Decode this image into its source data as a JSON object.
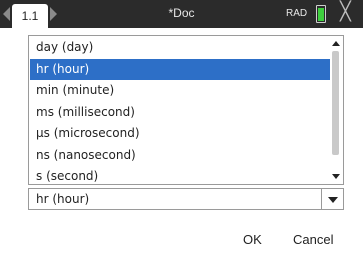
{
  "topbar": {
    "tab_label": "1.1",
    "doc_title": "*Doc",
    "mode": "RAD",
    "close_glyph": "╳"
  },
  "background": {
    "label": "U"
  },
  "list": {
    "items": [
      {
        "label": "day (day)"
      },
      {
        "label": "hr (hour)"
      },
      {
        "label": "min (minute)"
      },
      {
        "label": "ms (millisecond)"
      },
      {
        "label": "µs (microsecond)"
      },
      {
        "label": "ns (nanosecond)"
      },
      {
        "label": "s (second)"
      }
    ],
    "selected_index": 1
  },
  "combo": {
    "value": "hr (hour)"
  },
  "buttons": {
    "ok": "OK",
    "cancel": "Cancel"
  },
  "colors": {
    "topbar": "#2b2b2b",
    "selection": "#2d6fc7",
    "battery": "#3ecf3e"
  },
  "icons": [
    "nav-left-icon",
    "nav-right-icon",
    "battery-icon",
    "close-icon",
    "scroll-up-icon",
    "scroll-down-icon",
    "chevron-down-icon"
  ]
}
